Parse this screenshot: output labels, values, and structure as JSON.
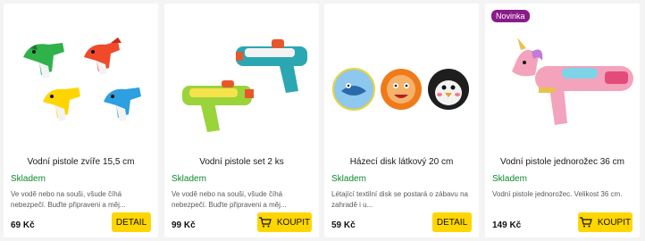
{
  "products": [
    {
      "title": "Vodní pistole zvíře 15,5 cm",
      "stock": "Skladem",
      "description": "Ve vodě nebo na souši, všude číhá nebezpečí. Buďte připraveni a měj...",
      "price": "69 Kč",
      "button_label": "DETAIL",
      "button_icon": "none",
      "image_icon": "animal-water-guns-image"
    },
    {
      "title": "Vodní pistole set 2 ks",
      "stock": "Skladem",
      "description": "Ve vodě nebo na souši, všude číhá nebezpečí. Buďte připraveni a měj...",
      "price": "99 Kč",
      "button_label": "KOUPIT",
      "button_icon": "cart-icon",
      "image_icon": "water-gun-set-image"
    },
    {
      "title": "Házecí disk látkový 20 cm",
      "stock": "Skladem",
      "description": "Létající textilní disk se postará o zábavu na zahradě i u...",
      "price": "59 Kč",
      "button_label": "DETAIL",
      "button_icon": "none",
      "image_icon": "fabric-discs-image"
    },
    {
      "badge": "Novinka",
      "title": "Vodní pistole jednorožec 36 cm",
      "stock": "Skladem",
      "description": "Vodní pistole jednorožec. Velikost 36 cm.",
      "price": "149 Kč",
      "button_label": "KOUPIT",
      "button_icon": "cart-icon",
      "image_icon": "unicorn-water-gun-image"
    }
  ],
  "colors": {
    "stock_green": "#0a8a2a",
    "button_yellow": "#ffd600",
    "badge_purple": "#8a1b8a"
  }
}
